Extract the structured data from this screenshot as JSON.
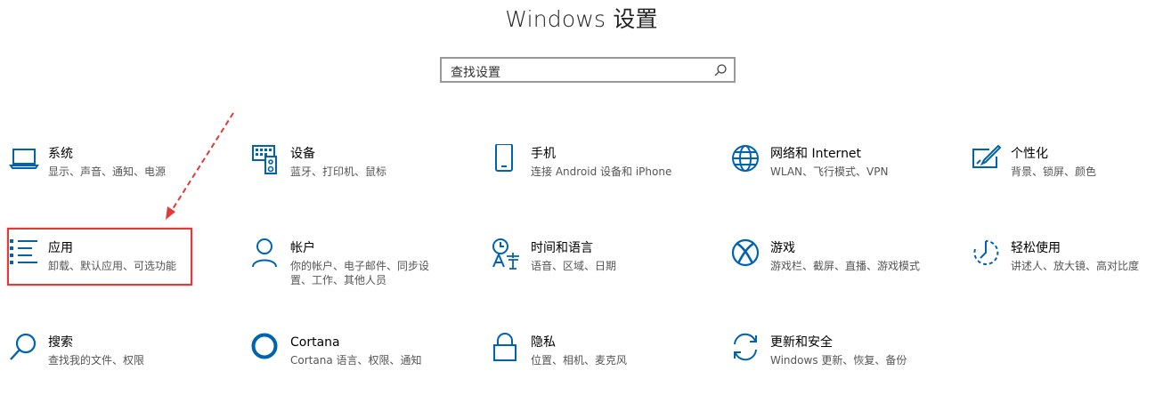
{
  "window": {
    "title": "Windows 设置"
  },
  "search": {
    "placeholder": "查找设置"
  },
  "tiles": [
    {
      "name": "系统",
      "desc": "显示、声音、通知、电源"
    },
    {
      "name": "设备",
      "desc": "蓝牙、打印机、鼠标"
    },
    {
      "name": "手机",
      "desc": "连接 Android 设备和 iPhone"
    },
    {
      "name": "网络和 Internet",
      "desc": "WLAN、飞行模式、VPN"
    },
    {
      "name": "个性化",
      "desc": "背景、锁屏、颜色"
    },
    {
      "name": "应用",
      "desc": "卸载、默认应用、可选功能"
    },
    {
      "name": "帐户",
      "desc": "你的帐户、电子邮件、同步设\n置、工作、其他人员"
    },
    {
      "name": "时间和语言",
      "desc": "语音、区域、日期"
    },
    {
      "name": "游戏",
      "desc": "游戏栏、截屏、直播、游戏模式"
    },
    {
      "name": "轻松使用",
      "desc": "讲述人、放大镜、高对比度"
    },
    {
      "name": "搜索",
      "desc": "查找我的文件、权限"
    },
    {
      "name": "Cortana",
      "desc": "Cortana 语言、权限、通知"
    },
    {
      "name": "隐私",
      "desc": "位置、相机、麦克风"
    },
    {
      "name": "更新和安全",
      "desc": "Windows 更新、恢复、备份"
    }
  ],
  "icons": {
    "accent": "#0063b1",
    "highlight": "#e03a3a"
  }
}
